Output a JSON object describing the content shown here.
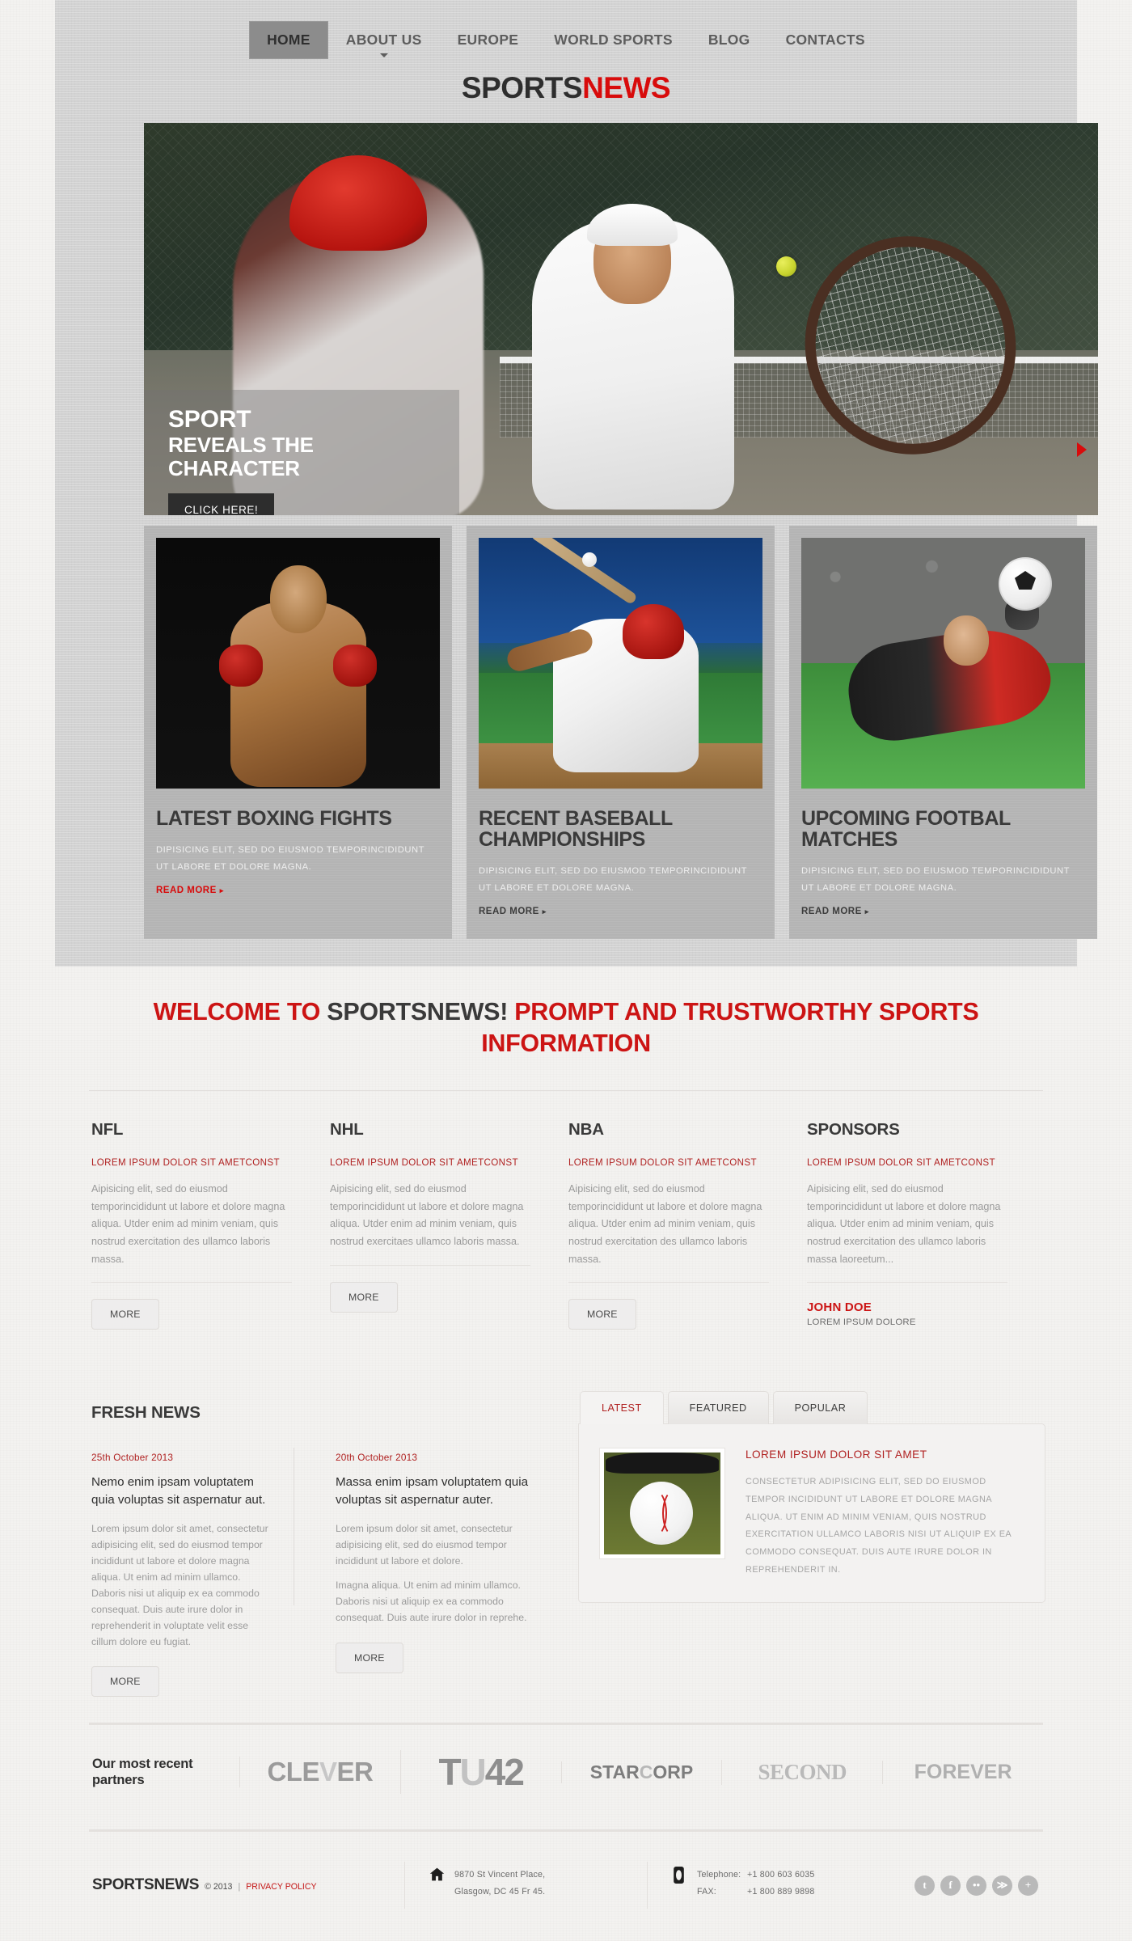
{
  "nav": {
    "items": [
      {
        "label": "HOME",
        "active": true,
        "caret": false
      },
      {
        "label": "ABOUT US",
        "active": false,
        "caret": true
      },
      {
        "label": "EUROPE",
        "active": false,
        "caret": false
      },
      {
        "label": "WORLD SPORTS",
        "active": false,
        "caret": false
      },
      {
        "label": "BLOG",
        "active": false,
        "caret": false
      },
      {
        "label": "CONTACTS",
        "active": false,
        "caret": false
      }
    ]
  },
  "logo": {
    "part1": "SPORTS",
    "part2": "NEWS"
  },
  "hero": {
    "title_line1": "SPORT",
    "title_line2": "REVEALS THE",
    "title_line3": "CHARACTER",
    "button": "CLICK HERE!"
  },
  "cards": [
    {
      "title": "LATEST BOXING FIGHTS",
      "desc": "DIPISICING ELIT, SED DO EIUSMOD TEMPORINCIDIDUNT UT LABORE ET DOLORE MAGNA.",
      "more": "READ MORE",
      "more_color": "red"
    },
    {
      "title": "RECENT BASEBALL CHAMPIONSHIPS",
      "desc": "DIPISICING ELIT, SED DO EIUSMOD TEMPORINCIDIDUNT UT LABORE ET DOLORE MAGNA.",
      "more": "READ MORE",
      "more_color": "dark"
    },
    {
      "title": "UPCOMING FOOTBAL MATCHES",
      "desc": "DIPISICING ELIT, SED DO EIUSMOD TEMPORINCIDIDUNT UT LABORE ET DOLORE MAGNA.",
      "more": "READ MORE",
      "more_color": "dark"
    }
  ],
  "welcome": {
    "seg1": "WELCOME TO ",
    "seg2": "SPORTSNEWS!",
    "seg3": " PROMPT AND TRUSTWORTHY SPORTS INFORMATION"
  },
  "columns": [
    {
      "heading": "NFL",
      "subheading": "LOREM IPSUM DOLOR SIT AMETCONST",
      "body": "Aipisicing elit, sed do eiusmod temporincididunt ut labore et dolore magna aliqua. Utder enim ad minim veniam, quis nostrud exercitation des ullamco laboris massa.",
      "button": "MORE"
    },
    {
      "heading": "NHL",
      "subheading": "LOREM IPSUM DOLOR SIT AMETCONST",
      "body": "Aipisicing elit, sed do eiusmod temporincididunt ut labore et dolore magna aliqua. Utder enim ad minim veniam, quis nostrud exercitaes ullamco laboris massa.",
      "button": "MORE"
    },
    {
      "heading": "NBA",
      "subheading": "LOREM IPSUM DOLOR SIT AMETCONST",
      "body": "Aipisicing elit, sed do eiusmod temporincididunt ut labore et dolore magna aliqua. Utder enim ad minim veniam, quis nostrud exercitation des ullamco laboris massa.",
      "button": "MORE"
    }
  ],
  "sponsors": {
    "heading": "SPONSORS",
    "subheading": "LOREM IPSUM DOLOR SIT AMETCONST",
    "body": "Aipisicing elit, sed do eiusmod temporincididunt ut labore et dolore magna aliqua. Utder enim ad minim veniam, quis nostrud exercitation des ullamco laboris massa laoreetum...",
    "name": "JOHN DOE",
    "role": "LOREM IPSUM DOLORE"
  },
  "fresh_news": {
    "heading": "FRESH NEWS",
    "items": [
      {
        "date": "25th October 2013",
        "title": "Nemo enim ipsam voluptatem quia voluptas sit aspernatur aut.",
        "body1": "Lorem ipsum dolor sit amet, consectetur adipisicing elit, sed do eiusmod tempor incididunt ut labore et dolore magna aliqua. Ut enim ad minim  ullamco.",
        "body2": "Daboris nisi ut aliquip ex ea commodo consequat. Duis aute irure dolor in reprehenderit in voluptate velit esse cillum dolore eu fugiat.",
        "button": "MORE"
      },
      {
        "date": "20th October 2013",
        "title": "Massa enim ipsam voluptatem quia voluptas sit aspernatur auter.",
        "body1": "Lorem ipsum dolor sit amet, consectetur adipisicing elit, sed do eiusmod tempor incididunt ut labore et dolore.",
        "body2": "Imagna aliqua. Ut enim ad minim  ullamco. Daboris nisi ut aliquip ex ea commodo consequat. Duis aute irure dolor in reprehe.",
        "button": "MORE"
      }
    ]
  },
  "tabs": {
    "items": [
      {
        "label": "LATEST",
        "active": true
      },
      {
        "label": "FEATURED",
        "active": false
      },
      {
        "label": "POPULAR",
        "active": false
      }
    ],
    "panel": {
      "title": "LOREM IPSUM DOLOR SIT AMET",
      "body": "CONSECTETUR ADIPISICING ELIT, SED DO EIUSMOD TEMPOR INCIDIDUNT UT LABORE ET DOLORE MAGNA ALIQUA. UT ENIM AD MINIM VENIAM, QUIS NOSTRUD EXERCITATION ULLAMCO LABORIS NISI UT ALIQUIP EX EA COMMODO CONSEQUAT. DUIS AUTE IRURE DOLOR IN REPREHENDERIT IN."
    }
  },
  "partners": {
    "label": "Our most recent partners",
    "items": [
      {
        "name": "CLEVER",
        "p1": "CLE",
        "p2": "V",
        "p3": "ER",
        "style": "clever"
      },
      {
        "name": "TU42",
        "p1": "T",
        "p2": "U",
        "p3": "42",
        "style": "tu42"
      },
      {
        "name": "STARCORP",
        "p1": "STAR",
        "p2": "C",
        "p3": "ORP",
        "style": "star"
      },
      {
        "name": "SECOND",
        "p1": "SECOND",
        "p2": "",
        "p3": "",
        "style": "second"
      },
      {
        "name": "FOREVER",
        "p1": "FOREVER",
        "p2": "",
        "p3": "",
        "style": "forever"
      }
    ]
  },
  "footer": {
    "logo": "SPORTSNEWS",
    "copyright": "© 2013",
    "separator": "|",
    "privacy": "PRIVACY POLICY",
    "address_line1": "9870 St Vincent Place,",
    "address_line2": "Glasgow, DC 45 Fr 45.",
    "phone_label": "Telephone:",
    "phone_value": "+1 800 603 6035",
    "fax_label": "FAX:",
    "fax_value": "+1 800 889 9898",
    "social": [
      {
        "name": "twitter",
        "glyph": "t"
      },
      {
        "name": "facebook",
        "glyph": "f"
      },
      {
        "name": "flickr",
        "glyph": "••"
      },
      {
        "name": "rss",
        "glyph": "≫"
      },
      {
        "name": "more",
        "glyph": "+"
      }
    ]
  }
}
